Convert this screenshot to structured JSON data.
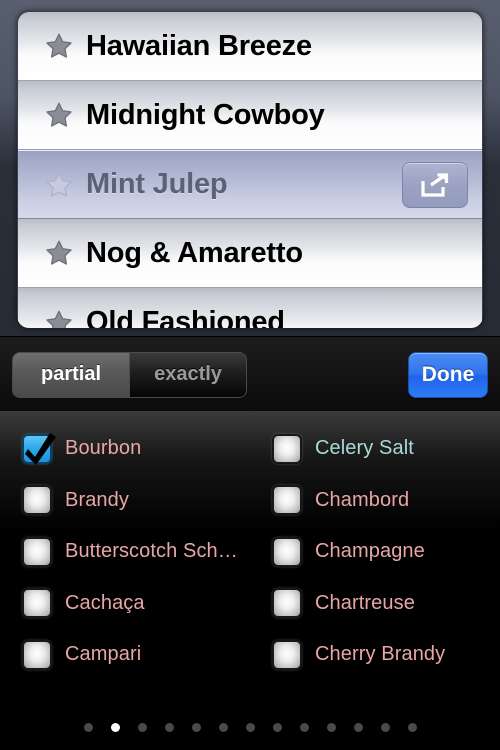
{
  "recipe_list": {
    "rows": [
      {
        "title": "Hawaiian Breeze",
        "selected": false,
        "icon": "star-icon"
      },
      {
        "title": "Midnight Cowboy",
        "selected": false,
        "icon": "star-icon"
      },
      {
        "title": "Mint Julep",
        "selected": true,
        "icon": "star-icon",
        "action_icon": "share-icon"
      },
      {
        "title": "Nog & Amaretto",
        "selected": false,
        "icon": "star-icon"
      },
      {
        "title": "Old Fashioned",
        "selected": false,
        "icon": "star-icon"
      }
    ]
  },
  "toolbar": {
    "segments": [
      {
        "label": "partial",
        "selected": true
      },
      {
        "label": "exactly",
        "selected": false
      }
    ],
    "done_label": "Done",
    "done_color": "#2f72ee"
  },
  "ingredients": {
    "left_column": [
      {
        "label": "Bourbon",
        "checked": true,
        "color": "#e8a6a6"
      },
      {
        "label": "Brandy",
        "checked": false,
        "color": "#e8a6a6"
      },
      {
        "label": "Butterscotch Sch…",
        "checked": false,
        "color": "#e8a6a6"
      },
      {
        "label": "Cachaça",
        "checked": false,
        "color": "#e8a6a6"
      },
      {
        "label": "Campari",
        "checked": false,
        "color": "#e8a6a6"
      }
    ],
    "right_column": [
      {
        "label": "Celery Salt",
        "checked": false,
        "color": "#a6dcd6"
      },
      {
        "label": "Chambord",
        "checked": false,
        "color": "#e8a6a6"
      },
      {
        "label": "Champagne",
        "checked": false,
        "color": "#e8a6a6"
      },
      {
        "label": "Chartreuse",
        "checked": false,
        "color": "#e8a6a6"
      },
      {
        "label": "Cherry Brandy",
        "checked": false,
        "color": "#e8a6a6"
      }
    ]
  },
  "pagination": {
    "total": 13,
    "active_index": 1
  }
}
